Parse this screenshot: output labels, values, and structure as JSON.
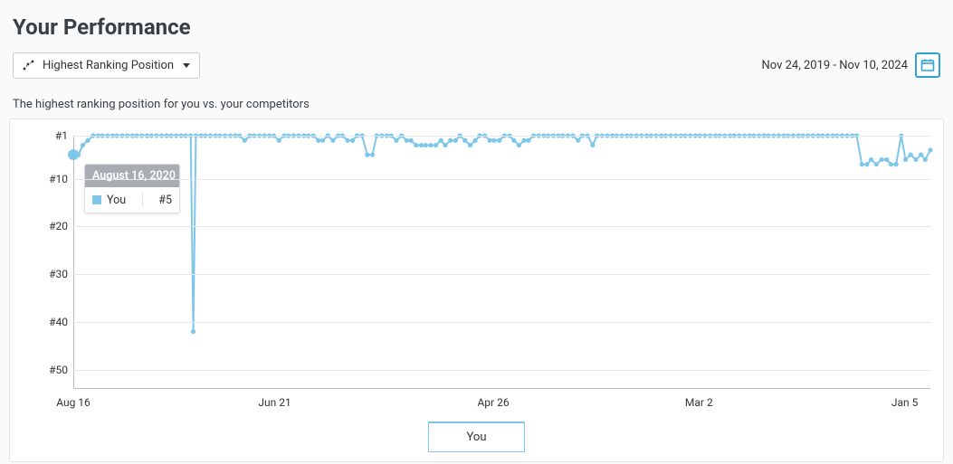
{
  "title": "Your Performance",
  "dropdown": {
    "label": "Highest Ranking Position"
  },
  "date_range": "Nov 24, 2019 - Nov 10, 2024",
  "subtitle": "The highest ranking position for you vs. your competitors",
  "legend_label": "You",
  "tooltip": {
    "date": "August 16, 2020",
    "series": "You",
    "value": "#5"
  },
  "chart_data": {
    "type": "line",
    "title": "",
    "xlabel": "",
    "ylabel": "",
    "y_ticks": [
      "#1",
      "#10",
      "#20",
      "#30",
      "#40",
      "#50"
    ],
    "y_range": [
      1,
      54
    ],
    "x_tick_labels": [
      "Aug 16",
      "Jun 21",
      "Apr 26",
      "Mar 2",
      "Jan 5"
    ],
    "x_tick_positions_pct": [
      0,
      23.5,
      49,
      73,
      97
    ],
    "series": [
      {
        "name": "You",
        "color": "#7ec7eb",
        "points": [
          {
            "x": 0.0,
            "rank": 5
          },
          {
            "x": 0.006,
            "rank": 5
          },
          {
            "x": 0.011,
            "rank": 3
          },
          {
            "x": 0.017,
            "rank": 2
          },
          {
            "x": 0.023,
            "rank": 1
          },
          {
            "x": 0.029,
            "rank": 1
          },
          {
            "x": 0.034,
            "rank": 1
          },
          {
            "x": 0.04,
            "rank": 1
          },
          {
            "x": 0.046,
            "rank": 1
          },
          {
            "x": 0.051,
            "rank": 1
          },
          {
            "x": 0.057,
            "rank": 1
          },
          {
            "x": 0.063,
            "rank": 1
          },
          {
            "x": 0.069,
            "rank": 1
          },
          {
            "x": 0.074,
            "rank": 1
          },
          {
            "x": 0.08,
            "rank": 1
          },
          {
            "x": 0.086,
            "rank": 1
          },
          {
            "x": 0.091,
            "rank": 1
          },
          {
            "x": 0.097,
            "rank": 1
          },
          {
            "x": 0.103,
            "rank": 1
          },
          {
            "x": 0.109,
            "rank": 1
          },
          {
            "x": 0.114,
            "rank": 1
          },
          {
            "x": 0.12,
            "rank": 1
          },
          {
            "x": 0.126,
            "rank": 1
          },
          {
            "x": 0.131,
            "rank": 1
          },
          {
            "x": 0.137,
            "rank": 1
          },
          {
            "x": 0.14,
            "rank": 42
          },
          {
            "x": 0.143,
            "rank": 1
          },
          {
            "x": 0.149,
            "rank": 1
          },
          {
            "x": 0.154,
            "rank": 1
          },
          {
            "x": 0.16,
            "rank": 1
          },
          {
            "x": 0.166,
            "rank": 1
          },
          {
            "x": 0.171,
            "rank": 1
          },
          {
            "x": 0.177,
            "rank": 1
          },
          {
            "x": 0.183,
            "rank": 1
          },
          {
            "x": 0.189,
            "rank": 1
          },
          {
            "x": 0.194,
            "rank": 1
          },
          {
            "x": 0.2,
            "rank": 2
          },
          {
            "x": 0.206,
            "rank": 1
          },
          {
            "x": 0.211,
            "rank": 1
          },
          {
            "x": 0.217,
            "rank": 1
          },
          {
            "x": 0.223,
            "rank": 1
          },
          {
            "x": 0.229,
            "rank": 1
          },
          {
            "x": 0.234,
            "rank": 1
          },
          {
            "x": 0.24,
            "rank": 2
          },
          {
            "x": 0.246,
            "rank": 1
          },
          {
            "x": 0.251,
            "rank": 1
          },
          {
            "x": 0.257,
            "rank": 1
          },
          {
            "x": 0.263,
            "rank": 1
          },
          {
            "x": 0.269,
            "rank": 1
          },
          {
            "x": 0.274,
            "rank": 1
          },
          {
            "x": 0.28,
            "rank": 1
          },
          {
            "x": 0.286,
            "rank": 2
          },
          {
            "x": 0.291,
            "rank": 2
          },
          {
            "x": 0.297,
            "rank": 1
          },
          {
            "x": 0.303,
            "rank": 2
          },
          {
            "x": 0.309,
            "rank": 1
          },
          {
            "x": 0.314,
            "rank": 1
          },
          {
            "x": 0.32,
            "rank": 2
          },
          {
            "x": 0.326,
            "rank": 2
          },
          {
            "x": 0.331,
            "rank": 1
          },
          {
            "x": 0.337,
            "rank": 1
          },
          {
            "x": 0.343,
            "rank": 5
          },
          {
            "x": 0.349,
            "rank": 5
          },
          {
            "x": 0.354,
            "rank": 1
          },
          {
            "x": 0.36,
            "rank": 1
          },
          {
            "x": 0.366,
            "rank": 1
          },
          {
            "x": 0.371,
            "rank": 1
          },
          {
            "x": 0.377,
            "rank": 2
          },
          {
            "x": 0.383,
            "rank": 1
          },
          {
            "x": 0.389,
            "rank": 2
          },
          {
            "x": 0.394,
            "rank": 2
          },
          {
            "x": 0.4,
            "rank": 3
          },
          {
            "x": 0.406,
            "rank": 3
          },
          {
            "x": 0.411,
            "rank": 3
          },
          {
            "x": 0.417,
            "rank": 3
          },
          {
            "x": 0.423,
            "rank": 3
          },
          {
            "x": 0.429,
            "rank": 2
          },
          {
            "x": 0.434,
            "rank": 3
          },
          {
            "x": 0.44,
            "rank": 2
          },
          {
            "x": 0.446,
            "rank": 2
          },
          {
            "x": 0.451,
            "rank": 1
          },
          {
            "x": 0.457,
            "rank": 2
          },
          {
            "x": 0.463,
            "rank": 3
          },
          {
            "x": 0.469,
            "rank": 2
          },
          {
            "x": 0.474,
            "rank": 1
          },
          {
            "x": 0.48,
            "rank": 1
          },
          {
            "x": 0.486,
            "rank": 2
          },
          {
            "x": 0.491,
            "rank": 2
          },
          {
            "x": 0.497,
            "rank": 2
          },
          {
            "x": 0.503,
            "rank": 1
          },
          {
            "x": 0.509,
            "rank": 1
          },
          {
            "x": 0.514,
            "rank": 2
          },
          {
            "x": 0.52,
            "rank": 3
          },
          {
            "x": 0.526,
            "rank": 2
          },
          {
            "x": 0.531,
            "rank": 2
          },
          {
            "x": 0.537,
            "rank": 1
          },
          {
            "x": 0.543,
            "rank": 1
          },
          {
            "x": 0.549,
            "rank": 1
          },
          {
            "x": 0.554,
            "rank": 1
          },
          {
            "x": 0.56,
            "rank": 1
          },
          {
            "x": 0.566,
            "rank": 1
          },
          {
            "x": 0.571,
            "rank": 1
          },
          {
            "x": 0.577,
            "rank": 1
          },
          {
            "x": 0.583,
            "rank": 1
          },
          {
            "x": 0.589,
            "rank": 2
          },
          {
            "x": 0.594,
            "rank": 1
          },
          {
            "x": 0.6,
            "rank": 1
          },
          {
            "x": 0.606,
            "rank": 3
          },
          {
            "x": 0.611,
            "rank": 1
          },
          {
            "x": 0.617,
            "rank": 1
          },
          {
            "x": 0.623,
            "rank": 1
          },
          {
            "x": 0.629,
            "rank": 1
          },
          {
            "x": 0.634,
            "rank": 1
          },
          {
            "x": 0.64,
            "rank": 1
          },
          {
            "x": 0.646,
            "rank": 1
          },
          {
            "x": 0.651,
            "rank": 1
          },
          {
            "x": 0.657,
            "rank": 1
          },
          {
            "x": 0.663,
            "rank": 1
          },
          {
            "x": 0.669,
            "rank": 1
          },
          {
            "x": 0.674,
            "rank": 1
          },
          {
            "x": 0.68,
            "rank": 1
          },
          {
            "x": 0.686,
            "rank": 1
          },
          {
            "x": 0.691,
            "rank": 1
          },
          {
            "x": 0.697,
            "rank": 1
          },
          {
            "x": 0.703,
            "rank": 1
          },
          {
            "x": 0.709,
            "rank": 1
          },
          {
            "x": 0.714,
            "rank": 1
          },
          {
            "x": 0.72,
            "rank": 1
          },
          {
            "x": 0.726,
            "rank": 1
          },
          {
            "x": 0.731,
            "rank": 1
          },
          {
            "x": 0.737,
            "rank": 1
          },
          {
            "x": 0.743,
            "rank": 1
          },
          {
            "x": 0.749,
            "rank": 1
          },
          {
            "x": 0.754,
            "rank": 1
          },
          {
            "x": 0.76,
            "rank": 1
          },
          {
            "x": 0.766,
            "rank": 1
          },
          {
            "x": 0.771,
            "rank": 1
          },
          {
            "x": 0.777,
            "rank": 1
          },
          {
            "x": 0.783,
            "rank": 1
          },
          {
            "x": 0.789,
            "rank": 1
          },
          {
            "x": 0.794,
            "rank": 1
          },
          {
            "x": 0.8,
            "rank": 1
          },
          {
            "x": 0.806,
            "rank": 1
          },
          {
            "x": 0.811,
            "rank": 1
          },
          {
            "x": 0.817,
            "rank": 1
          },
          {
            "x": 0.823,
            "rank": 1
          },
          {
            "x": 0.829,
            "rank": 1
          },
          {
            "x": 0.834,
            "rank": 1
          },
          {
            "x": 0.84,
            "rank": 1
          },
          {
            "x": 0.846,
            "rank": 1
          },
          {
            "x": 0.851,
            "rank": 1
          },
          {
            "x": 0.857,
            "rank": 1
          },
          {
            "x": 0.863,
            "rank": 1
          },
          {
            "x": 0.869,
            "rank": 1
          },
          {
            "x": 0.874,
            "rank": 1
          },
          {
            "x": 0.88,
            "rank": 1
          },
          {
            "x": 0.886,
            "rank": 1
          },
          {
            "x": 0.891,
            "rank": 1
          },
          {
            "x": 0.897,
            "rank": 1
          },
          {
            "x": 0.903,
            "rank": 1
          },
          {
            "x": 0.909,
            "rank": 1
          },
          {
            "x": 0.914,
            "rank": 1
          },
          {
            "x": 0.92,
            "rank": 7
          },
          {
            "x": 0.926,
            "rank": 7
          },
          {
            "x": 0.931,
            "rank": 6
          },
          {
            "x": 0.937,
            "rank": 7
          },
          {
            "x": 0.943,
            "rank": 6
          },
          {
            "x": 0.949,
            "rank": 6
          },
          {
            "x": 0.954,
            "rank": 7
          },
          {
            "x": 0.96,
            "rank": 7
          },
          {
            "x": 0.966,
            "rank": 1
          },
          {
            "x": 0.971,
            "rank": 6
          },
          {
            "x": 0.977,
            "rank": 5
          },
          {
            "x": 0.983,
            "rank": 6
          },
          {
            "x": 0.989,
            "rank": 5
          },
          {
            "x": 0.994,
            "rank": 6
          },
          {
            "x": 1.0,
            "rank": 4
          }
        ]
      }
    ]
  }
}
